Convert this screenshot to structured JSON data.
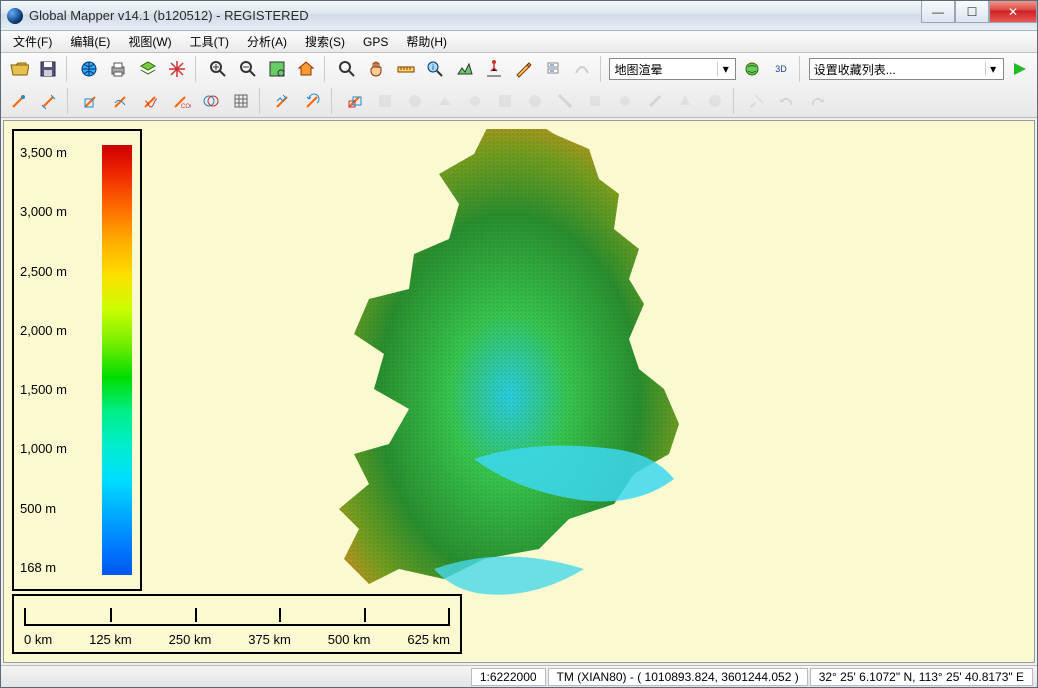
{
  "window": {
    "title": "Global Mapper v14.1 (b120512) - REGISTERED"
  },
  "menus": {
    "file": "文件(F)",
    "edit": "编辑(E)",
    "view": "视图(W)",
    "tools": "工具(T)",
    "analysis": "分析(A)",
    "search": "搜索(S)",
    "gps": "GPS",
    "help": "帮助(H)"
  },
  "toolbar": {
    "shader_combo": "地图渲晕",
    "favorites_combo": "设置收藏列表..."
  },
  "legend": {
    "ticks": [
      "3,500 m",
      "3,000 m",
      "2,500 m",
      "2,000 m",
      "1,500 m",
      "1,000 m",
      "500 m",
      "168 m"
    ]
  },
  "scalebar": {
    "labels": [
      "0 km",
      "125 km",
      "250 km",
      "375 km",
      "500 km",
      "625 km"
    ]
  },
  "status": {
    "scale": "1:6222000",
    "proj": "TM (XIAN80) - ( 1010893.824, 3601244.052 )",
    "latlon": "32° 25' 6.1072\" N, 113° 25' 40.8173\" E"
  }
}
